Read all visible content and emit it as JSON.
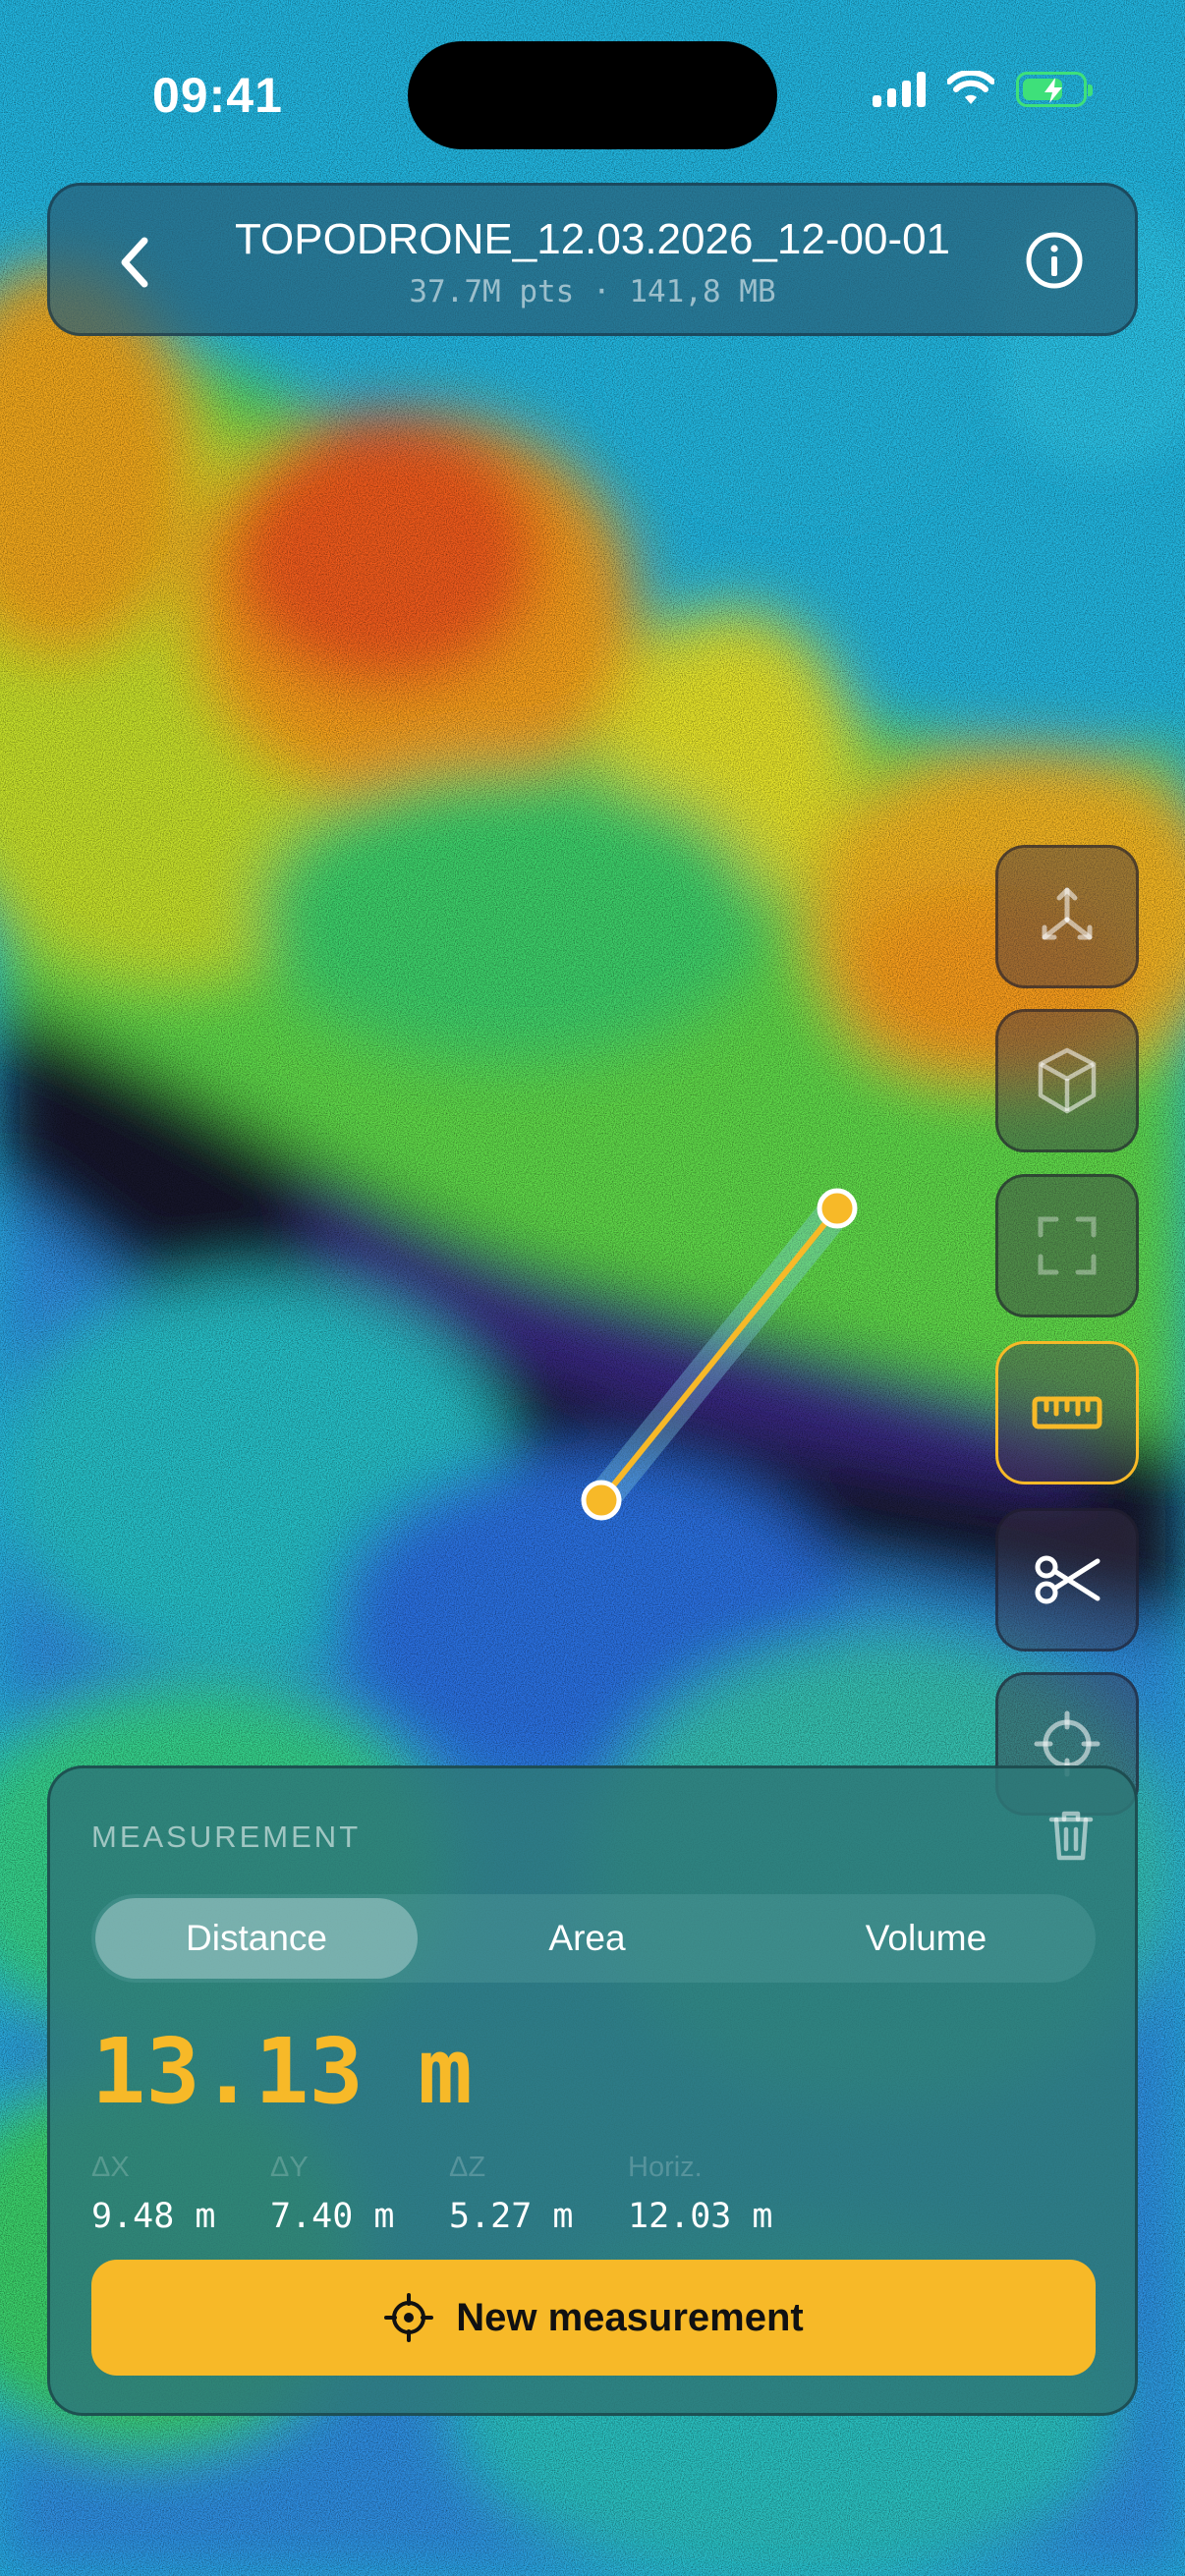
{
  "status": {
    "time": "09:41"
  },
  "header": {
    "title": "TOPODRONE_12.03.2026_12-00-01",
    "subtitle": "37.7M pts · 141,8 MB"
  },
  "tools": [
    {
      "icon": "axes-icon",
      "active": false
    },
    {
      "icon": "cube-icon",
      "active": false
    },
    {
      "icon": "frame-icon",
      "active": false
    },
    {
      "icon": "ruler-icon",
      "active": true
    },
    {
      "icon": "scissors-icon",
      "active": false
    },
    {
      "icon": "crosshair-icon",
      "active": false
    }
  ],
  "measurement": {
    "label": "MEASUREMENT",
    "tabs": [
      "Distance",
      "Area",
      "Volume"
    ],
    "selected_tab": "Distance",
    "value": "13.13 m",
    "deltas": [
      {
        "label": "ΔX",
        "value": "9.48 m"
      },
      {
        "label": "ΔY",
        "value": "7.40 m"
      },
      {
        "label": "ΔZ",
        "value": "5.27 m"
      },
      {
        "label": "Horiz.",
        "value": "12.03 m"
      }
    ],
    "new_button": "New measurement"
  },
  "colors": {
    "accent": "#f7b928",
    "battery": "#3ee07a",
    "water": "#23b7e0"
  }
}
